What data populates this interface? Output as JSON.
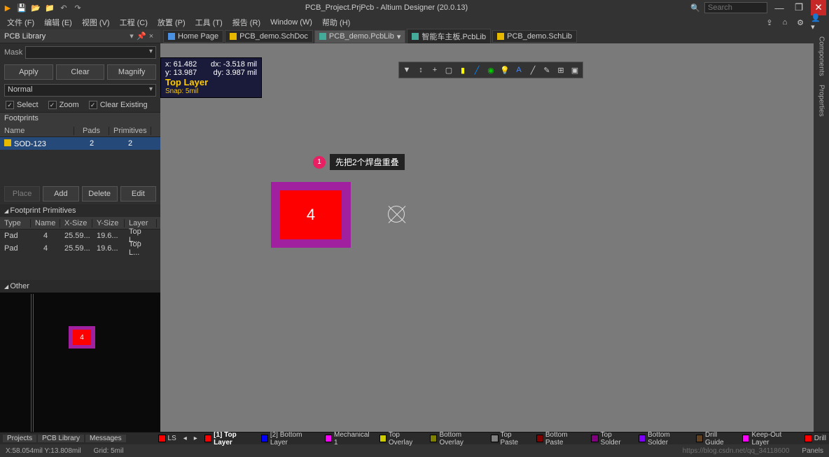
{
  "title": "PCB_Project.PrjPcb - Altium Designer (20.0.13)",
  "search_placeholder": "Search",
  "menu": [
    "文件 (F)",
    "编辑 (E)",
    "视图 (V)",
    "工程 (C)",
    "放置 (P)",
    "工具 (T)",
    "报告 (R)",
    "Window (W)",
    "帮助 (H)"
  ],
  "panel": {
    "title": "PCB Library",
    "mask_label": "Mask",
    "apply": "Apply",
    "clear": "Clear",
    "magnify": "Magnify",
    "mode": "Normal",
    "cb_select": "Select",
    "cb_zoom": "Zoom",
    "cb_clear": "Clear Existing",
    "footprints_hd": "Footprints",
    "cols": {
      "name": "Name",
      "pads": "Pads",
      "prim": "Primitives"
    },
    "row": {
      "name": "SOD-123",
      "pads": "2",
      "prim": "2"
    },
    "place": "Place",
    "add": "Add",
    "delete": "Delete",
    "edit": "Edit",
    "fpprim": "Footprint Primitives",
    "pcols": {
      "type": "Type",
      "name": "Name",
      "x": "X-Size",
      "y": "Y-Size",
      "layer": "Layer"
    },
    "prows": [
      {
        "type": "Pad",
        "name": "4",
        "x": "25.59...",
        "y": "19.6...",
        "layer": "Top L..."
      },
      {
        "type": "Pad",
        "name": "4",
        "x": "25.59...",
        "y": "19.6...",
        "layer": "Top L..."
      }
    ],
    "other": "Other",
    "preview_num": "4"
  },
  "tabs": [
    {
      "label": "Home Page",
      "cls": "home"
    },
    {
      "label": "PCB_demo.SchDoc",
      "cls": "sch"
    },
    {
      "label": "PCB_demo.PcbLib",
      "cls": "",
      "active": true
    },
    {
      "label": "智能车主板.PcbLib",
      "cls": ""
    },
    {
      "label": "PCB_demo.SchLib",
      "cls": "sch"
    }
  ],
  "coords": {
    "x": "x:   61.482",
    "dx": "dx:   -3.518 mil",
    "y": "y:   13.987",
    "dy": "dy:    3.987 mil",
    "layer": "Top Layer",
    "snap": "Snap: 5mil"
  },
  "anno": {
    "num": "1",
    "txt": "先把2个焊盘重叠"
  },
  "pad_num": "4",
  "right_tabs": [
    "Components",
    "Properties"
  ],
  "bottom_tabs": [
    "Projects",
    "PCB Library",
    "Messages"
  ],
  "layer_bar": {
    "ls": "LS",
    "items": [
      {
        "c": "#ff0000",
        "t": "[1] Top Layer",
        "b": true
      },
      {
        "c": "#0000ff",
        "t": "[2] Bottom Layer"
      },
      {
        "c": "#ff00ff",
        "t": "Mechanical 1"
      },
      {
        "c": "#cccc00",
        "t": "Top Overlay"
      },
      {
        "c": "#808000",
        "t": "Bottom Overlay"
      },
      {
        "c": "#808080",
        "t": "Top Paste"
      },
      {
        "c": "#800000",
        "t": "Bottom Paste"
      },
      {
        "c": "#800080",
        "t": "Top Solder"
      },
      {
        "c": "#8000ff",
        "t": "Bottom Solder"
      },
      {
        "c": "#604020",
        "t": "Drill Guide"
      },
      {
        "c": "#ff00ff",
        "t": "Keep-Out Layer"
      },
      {
        "c": "#ff0000",
        "t": "Drill"
      }
    ]
  },
  "status": {
    "coord": "X:58.054mil Y:13.808mil",
    "grid": "Grid: 5mil",
    "water": "https://blog.csdn.net/qq_34118600",
    "panels": "Panels"
  }
}
